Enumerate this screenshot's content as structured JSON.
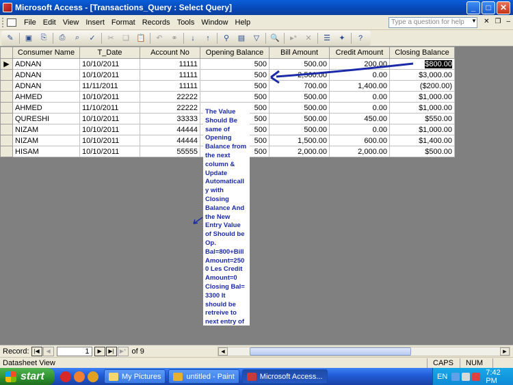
{
  "window": {
    "title": "Microsoft Access - [Transactions_Query : Select Query]"
  },
  "menubar": {
    "items": [
      "File",
      "Edit",
      "View",
      "Insert",
      "Format",
      "Records",
      "Tools",
      "Window",
      "Help"
    ],
    "help_placeholder": "Type a question for help"
  },
  "toolbar": {
    "icons": [
      "view-icon",
      "save-icon",
      "export-icon",
      "print-icon",
      "print-preview-icon",
      "spelling-icon",
      "cut-icon",
      "copy-icon",
      "paste-icon",
      "undo-icon",
      "insert-hyperlink-icon",
      "sort-ascending-icon",
      "sort-descending-icon",
      "filter-by-selection-icon",
      "filter-by-form-icon",
      "apply-filter-icon",
      "find-icon",
      "new-record-icon",
      "delete-record-icon",
      "properties-icon",
      "new-object-icon",
      "help-icon"
    ]
  },
  "table": {
    "columns": [
      "Consumer Name",
      "T_Date",
      "Account No",
      "Opening Balance",
      "Bill Amount",
      "Credit Amount",
      "Closing Balance"
    ],
    "rows": [
      [
        "ADNAN",
        "10/10/2011",
        "11111",
        "500",
        "500.00",
        "200.00",
        "$800.00"
      ],
      [
        "ADNAN",
        "10/10/2011",
        "11111",
        "500",
        "2,500.00",
        "0.00",
        "$3,000.00"
      ],
      [
        "ADNAN",
        "11/11/2011",
        "11111",
        "500",
        "700.00",
        "1,400.00",
        "($200.00)"
      ],
      [
        "AHMED",
        "10/10/2011",
        "22222",
        "500",
        "500.00",
        "0.00",
        "$1,000.00"
      ],
      [
        "AHMED",
        "11/10/2011",
        "22222",
        "500",
        "500.00",
        "0.00",
        "$1,000.00"
      ],
      [
        "QURESHI",
        "10/10/2011",
        "33333",
        "500",
        "500.00",
        "450.00",
        "$550.00"
      ],
      [
        "NIZAM",
        "10/10/2011",
        "44444",
        "500",
        "500.00",
        "0.00",
        "$1,000.00"
      ],
      [
        "NIZAM",
        "10/10/2011",
        "44444",
        "500",
        "1,500.00",
        "600.00",
        "$1,400.00"
      ],
      [
        "HISAM",
        "10/10/2011",
        "55555",
        "500",
        "2,000.00",
        "2,000.00",
        "$500.00"
      ]
    ]
  },
  "annotation": {
    "text": "The Value Should Be same of Opening Balance from the next column & Update Automaticall y with Closing Balance And the New Entry Value of  Should be Op. Bal=800+Bill Amount=2500 Les Credit Amount=0 Closing Bal= 3300 It should be retreive to next entry of Opening Bal.",
    "color": "#1a2aa8"
  },
  "navigation": {
    "record_label": "Record:",
    "current_record": "1",
    "of_label": "of 9"
  },
  "statusbar": {
    "view": "Datasheet View",
    "caps": "CAPS",
    "num": "NUM"
  },
  "taskbar": {
    "start_label": "start",
    "tasks": [
      "My Pictures",
      "untitled - Paint",
      "Microsoft Access..."
    ],
    "lang": "EN",
    "clock": "7:42 PM"
  }
}
